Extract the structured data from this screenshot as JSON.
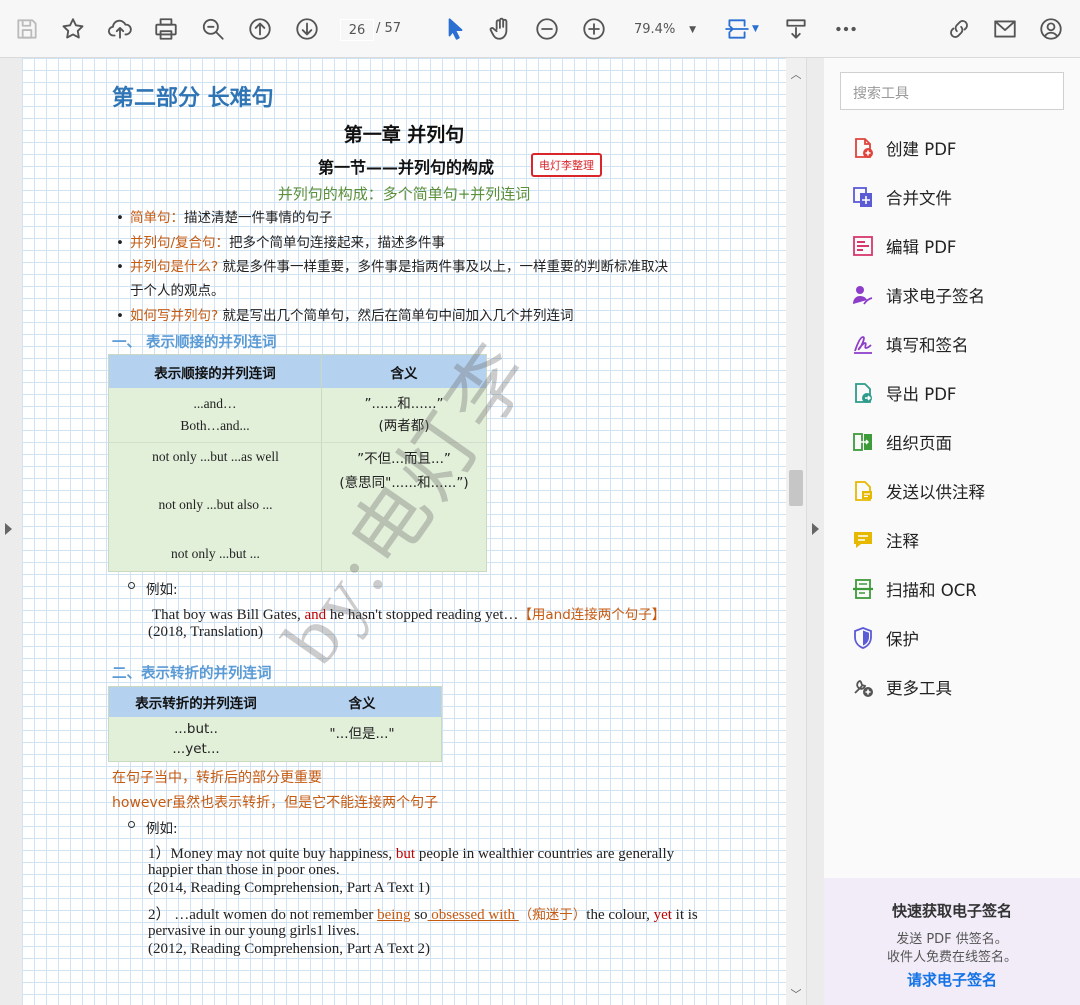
{
  "toolbar": {
    "page_current": "26",
    "page_total": "/ 57",
    "zoom": "79.4%"
  },
  "document": {
    "part_title": "第二部分  长难句",
    "chapter_title": "第一章  并列句",
    "section_title": "第一节——并列句的构成",
    "stamp": "电灯李整理",
    "composition": "并列句的构成：多个简单句+并列连词",
    "bullets": [
      {
        "term": "简单句：",
        "text": "描述清楚一件事情的句子"
      },
      {
        "term": "并列句/复合句：",
        "text": "把多个简单句连接起来，描述多件事"
      },
      {
        "term": "并列句是什么?",
        "text": " 就是多件事一样重要，多件事是指两件事及以上，一样重要的判断标准取决"
      },
      {
        "term": "",
        "text": "于个人的观点。"
      },
      {
        "term": "如何写并列句?",
        "text": " 就是写出几个简单句，然后在简单句中间加入几个并列连词"
      }
    ],
    "sec1": {
      "heading": "一、 表示顺接的并列连词",
      "table_header": [
        "表示顺接的并列连词",
        "含义"
      ],
      "rows": [
        {
          "left": [
            "...and…",
            "Both…and..."
          ],
          "right": [
            "”......和......”",
            "(两者都)"
          ]
        },
        {
          "left": [
            "not only ...but ...as well",
            "not only ...but also ...",
            "not only ...but ..."
          ],
          "right": [
            "”不但...而且...”",
            "(意思同\"......和......”)"
          ]
        }
      ],
      "example_label": "例如:",
      "example_a": "That boy was Bill Gates, ",
      "example_b": "and",
      "example_c": " he hasn't stopped reading yet…",
      "example_note": "【用and连接两个句子】",
      "example_src": "(2018, Translation)"
    },
    "sec2": {
      "heading": "二、表示转折的并列连词",
      "table_header": [
        "表示转折的并列连词",
        "含义"
      ],
      "row_left": [
        "...but..",
        "...yet..."
      ],
      "row_right": "\"...但是...\"",
      "note1": "在句子当中，转折后的部分更重要",
      "note2": "however虽然也表示转折，但是它不能连接两个句子",
      "example_label": "例如:",
      "ex1_a": "1）Money may not quite buy happiness, ",
      "ex1_b": "but",
      "ex1_c": " people in wealthier countries are generally",
      "ex1_d": "happier than those in poor ones.",
      "ex1_src": "(2014, Reading Comprehension, Part A Text 1)",
      "ex2_a": "2）  …adult women do not remember ",
      "ex2_b": "being",
      "ex2_c": " so",
      "ex2_d": " obsessed with ",
      "ex2_e": "（痴迷于）",
      "ex2_f": "the colour, ",
      "ex2_g": "yet",
      "ex2_h": " it is",
      "ex2_i": "pervasive in our young girls1 lives.",
      "ex2_src": "(2012, Reading Comprehension, Part A Text 2)"
    },
    "watermark": "by:电灯李"
  },
  "right_panel": {
    "search_placeholder": "搜索工具",
    "tools": [
      {
        "label": "创建 PDF",
        "icon": "create-pdf-icon",
        "color": "#e0433c"
      },
      {
        "label": "合并文件",
        "icon": "combine-files-icon",
        "color": "#5b5bd6"
      },
      {
        "label": "编辑 PDF",
        "icon": "edit-pdf-icon",
        "color": "#d6386b"
      },
      {
        "label": "请求电子签名",
        "icon": "request-signature-icon",
        "color": "#8d3dc9"
      },
      {
        "label": "填写和签名",
        "icon": "fill-sign-icon",
        "color": "#8d3dc9"
      },
      {
        "label": "导出 PDF",
        "icon": "export-pdf-icon",
        "color": "#2e9b8c"
      },
      {
        "label": "组织页面",
        "icon": "organize-pages-icon",
        "color": "#3d9b3a"
      },
      {
        "label": "发送以供注释",
        "icon": "send-comment-icon",
        "color": "#e6b800"
      },
      {
        "label": "注释",
        "icon": "comment-icon",
        "color": "#e6b800"
      },
      {
        "label": "扫描和 OCR",
        "icon": "scan-ocr-icon",
        "color": "#3d9b3a"
      },
      {
        "label": "保护",
        "icon": "protect-icon",
        "color": "#5b5bd6"
      },
      {
        "label": "更多工具",
        "icon": "more-tools-icon",
        "color": "#555555"
      }
    ],
    "promo": {
      "title": "快速获取电子签名",
      "line1": "发送 PDF 供签名。",
      "line2": "收件人免费在线签名。",
      "button": "请求电子签名"
    }
  }
}
